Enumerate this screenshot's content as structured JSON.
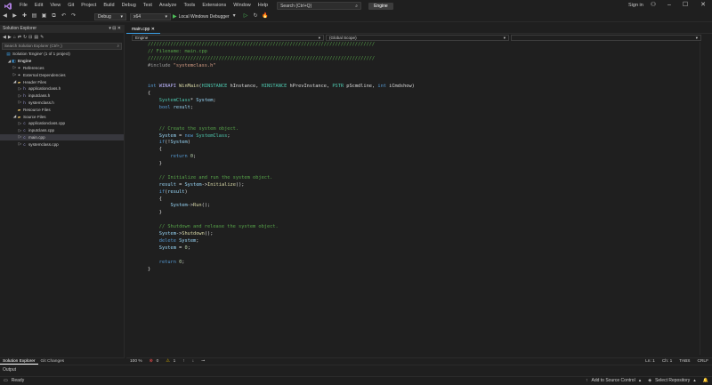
{
  "menu": [
    "File",
    "Edit",
    "View",
    "Git",
    "Project",
    "Build",
    "Debug",
    "Test",
    "Analyze",
    "Tools",
    "Extensions",
    "Window",
    "Help"
  ],
  "search": {
    "placeholder": "Search (Ctrl+Q)"
  },
  "solution_name_badge": "Engine",
  "sign_in": "Sign in",
  "toolbar": {
    "configuration": "Debug",
    "platform": "x64",
    "debugger": "Local Windows Debugger"
  },
  "solution_explorer": {
    "title": "Solution Explorer",
    "search_placeholder": "Search Solution Explorer (Ctrl+;)",
    "items": [
      {
        "label": "Solution 'Engine' (1 of 1 project)",
        "indent": 0,
        "icon": "solution-icon",
        "expander": ""
      },
      {
        "label": "Engine",
        "indent": 1,
        "icon": "project-icon",
        "expander": "◢",
        "bold": true
      },
      {
        "label": "References",
        "indent": 2,
        "icon": "references-icon",
        "expander": "▷"
      },
      {
        "label": "External Dependencies",
        "indent": 2,
        "icon": "external-deps-icon",
        "expander": "▷"
      },
      {
        "label": "Header Files",
        "indent": 2,
        "icon": "folder-icon",
        "expander": "◢"
      },
      {
        "label": "applicationclass.h",
        "indent": 3,
        "icon": "header-file-icon",
        "expander": "▷"
      },
      {
        "label": "inputclass.h",
        "indent": 3,
        "icon": "header-file-icon",
        "expander": "▷"
      },
      {
        "label": "systemclass.h",
        "indent": 3,
        "icon": "header-file-icon",
        "expander": "▷"
      },
      {
        "label": "Resource Files",
        "indent": 2,
        "icon": "folder-icon",
        "expander": ""
      },
      {
        "label": "Source Files",
        "indent": 2,
        "icon": "folder-icon",
        "expander": "◢"
      },
      {
        "label": "applicationclass.cpp",
        "indent": 3,
        "icon": "cpp-file-icon",
        "expander": "▷"
      },
      {
        "label": "inputclass.cpp",
        "indent": 3,
        "icon": "cpp-file-icon",
        "expander": "▷"
      },
      {
        "label": "main.cpp",
        "indent": 3,
        "icon": "cpp-file-icon",
        "expander": "▷",
        "selected": true
      },
      {
        "label": "systemclass.cpp",
        "indent": 3,
        "icon": "cpp-file-icon",
        "expander": "▷"
      }
    ],
    "tabs": [
      "Solution Explorer",
      "Git Changes"
    ]
  },
  "editor": {
    "tab": "main.cpp",
    "project_dropdown": "Engine",
    "scope_dropdown": "(Global Scope)",
    "lines": [
      [
        [
          "c-comment",
          "////////////////////////////////////////////////////////////////////////////////"
        ]
      ],
      [
        [
          "c-comment",
          "// Filename: main.cpp"
        ]
      ],
      [
        [
          "c-comment",
          "////////////////////////////////////////////////////////////////////////////////"
        ]
      ],
      [
        [
          "c-pp",
          "#include "
        ],
        [
          "c-str",
          "\"systemclass.h\""
        ]
      ],
      [],
      [],
      [
        [
          "c-kw",
          "int "
        ],
        [
          "c-macro",
          "WINAPI "
        ],
        [
          "c-fn",
          "WinMain"
        ],
        [
          "c-plain",
          "("
        ],
        [
          "c-type",
          "HINSTANCE "
        ],
        [
          "c-plain",
          "hInstance, "
        ],
        [
          "c-type",
          "HINSTANCE "
        ],
        [
          "c-plain",
          "hPrevInstance, "
        ],
        [
          "c-type",
          "PSTR "
        ],
        [
          "c-plain",
          "pScmdline, "
        ],
        [
          "c-kw",
          "int "
        ],
        [
          "c-plain",
          "iCmdshow)"
        ]
      ],
      [
        [
          "c-plain",
          "{"
        ]
      ],
      [
        [
          "c-plain",
          "    "
        ],
        [
          "c-type",
          "SystemClass"
        ],
        [
          "c-plain",
          "* "
        ],
        [
          "c-var",
          "System"
        ],
        [
          "c-plain",
          ";"
        ]
      ],
      [
        [
          "c-plain",
          "    "
        ],
        [
          "c-kw",
          "bool "
        ],
        [
          "c-var",
          "result"
        ],
        [
          "c-plain",
          ";"
        ]
      ],
      [],
      [],
      [
        [
          "c-plain",
          "    "
        ],
        [
          "c-comment",
          "// Create the system object."
        ]
      ],
      [
        [
          "c-plain",
          "    "
        ],
        [
          "c-var",
          "System"
        ],
        [
          "c-plain",
          " = "
        ],
        [
          "c-kw",
          "new "
        ],
        [
          "c-type",
          "SystemClass"
        ],
        [
          "c-plain",
          ";"
        ]
      ],
      [
        [
          "c-plain",
          "    "
        ],
        [
          "c-kw",
          "if"
        ],
        [
          "c-plain",
          "(!"
        ],
        [
          "c-var",
          "System"
        ],
        [
          "c-plain",
          ")"
        ]
      ],
      [
        [
          "c-plain",
          "    {"
        ]
      ],
      [
        [
          "c-plain",
          "        "
        ],
        [
          "c-kw",
          "return "
        ],
        [
          "c-num",
          "0"
        ],
        [
          "c-plain",
          ";"
        ]
      ],
      [
        [
          "c-plain",
          "    }"
        ]
      ],
      [],
      [
        [
          "c-plain",
          "    "
        ],
        [
          "c-comment",
          "// Initialize and run the system object."
        ]
      ],
      [
        [
          "c-plain",
          "    "
        ],
        [
          "c-var",
          "result"
        ],
        [
          "c-plain",
          " = "
        ],
        [
          "c-var",
          "System"
        ],
        [
          "c-plain",
          "->"
        ],
        [
          "c-fn",
          "Initialize"
        ],
        [
          "c-plain",
          "();"
        ]
      ],
      [
        [
          "c-plain",
          "    "
        ],
        [
          "c-kw",
          "if"
        ],
        [
          "c-plain",
          "("
        ],
        [
          "c-var",
          "result"
        ],
        [
          "c-plain",
          ")"
        ]
      ],
      [
        [
          "c-plain",
          "    {"
        ]
      ],
      [
        [
          "c-plain",
          "        "
        ],
        [
          "c-var",
          "System"
        ],
        [
          "c-plain",
          "->"
        ],
        [
          "c-fn",
          "Run"
        ],
        [
          "c-plain",
          "();"
        ]
      ],
      [
        [
          "c-plain",
          "    }"
        ]
      ],
      [],
      [
        [
          "c-plain",
          "    "
        ],
        [
          "c-comment",
          "// Shutdown and release the system object."
        ]
      ],
      [
        [
          "c-plain",
          "    "
        ],
        [
          "c-var",
          "System"
        ],
        [
          "c-plain",
          "->"
        ],
        [
          "c-fn",
          "Shutdown"
        ],
        [
          "c-plain",
          "();"
        ]
      ],
      [
        [
          "c-plain",
          "    "
        ],
        [
          "c-kw",
          "delete "
        ],
        [
          "c-var",
          "System"
        ],
        [
          "c-plain",
          ";"
        ]
      ],
      [
        [
          "c-plain",
          "    "
        ],
        [
          "c-var",
          "System"
        ],
        [
          "c-plain",
          " = "
        ],
        [
          "c-num",
          "0"
        ],
        [
          "c-plain",
          ";"
        ]
      ],
      [],
      [
        [
          "c-plain",
          "    "
        ],
        [
          "c-kw",
          "return "
        ],
        [
          "c-num",
          "0"
        ],
        [
          "c-plain",
          ";"
        ]
      ],
      [
        [
          "c-plain",
          "}"
        ]
      ]
    ],
    "status": {
      "zoom": "100 %",
      "errors": "0",
      "warnings": "1",
      "line": "Ln: 1",
      "col": "Ch: 1",
      "tabs": "TABS",
      "eol": "CRLF"
    }
  },
  "output_label": "Output",
  "statusbar": {
    "ready": "Ready",
    "add_source_control": "Add to Source Control",
    "select_repository": "Select Repository"
  },
  "colors": {
    "accent": "#3ba0e8",
    "play": "#4ec05a",
    "background": "#1f1f1f"
  }
}
